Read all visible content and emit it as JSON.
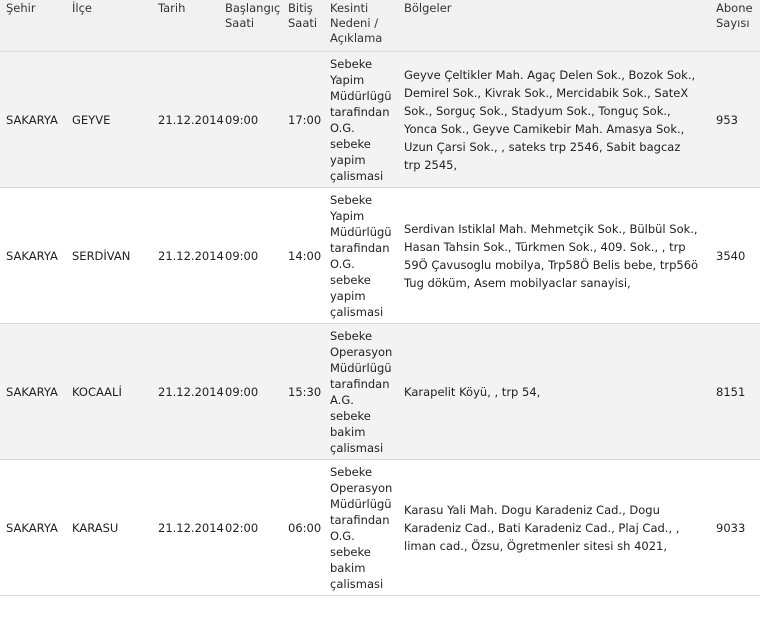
{
  "table": {
    "headers": {
      "city": "Şehir",
      "district": "İlçe",
      "date": "Tarih",
      "start_time": "Başlangıç\nSaati",
      "end_time": "Bitiş\nSaati",
      "reason": "Kesinti\nNedeni /\nAçıklama",
      "regions": "Bölgeler",
      "subscriber_count": "Abone\nSayısı"
    },
    "rows": [
      {
        "city": "SAKARYA",
        "district": "GEYVE",
        "date": "21.12.2014",
        "start_time": "09:00",
        "end_time": "17:00",
        "reason": "Sebeke\nYapim\nMüdürlügü\ntarafindan\nO.G.\nsebeke\nyapim\nçalismasi",
        "regions": "Geyve Çeltikler Mah. Agaç Delen Sok., Bozok Sok., Demirel Sok., Kivrak Sok., Mercidabik Sok., SateX Sok., Sorguç Sok., Stadyum Sok., Tonguç Sok., Yonca Sok., Geyve Camikebir Mah. Amasya Sok., Uzun Çarsi Sok., , sateks trp 2546, Sabit bagcaz trp 2545,",
        "subscriber_count": "953"
      },
      {
        "city": "SAKARYA",
        "district": "SERDİVAN",
        "date": "21.12.2014",
        "start_time": "09:00",
        "end_time": "14:00",
        "reason": "Sebeke\nYapim\nMüdürlügü\ntarafindan\nO.G.\nsebeke\nyapim\nçalismasi",
        "regions": "Serdivan Istiklal Mah. Mehmetçik Sok., Bülbül Sok., Hasan Tahsin Sok., Türkmen Sok., 409. Sok., , trp 59Ö Çavusoglu mobilya, Trp58Ö Belis bebe, trp56ö Tug döküm, Asem mobilyaclar sanayisi,",
        "subscriber_count": "3540"
      },
      {
        "city": "SAKARYA",
        "district": "KOCAALİ",
        "date": "21.12.2014",
        "start_time": "09:00",
        "end_time": "15:30",
        "reason": "Sebeke\nOperasyon\nMüdürlügü\ntarafindan\nA.G.\nsebeke\nbakim\nçalismasi",
        "regions": "Karapelit Köyü, , trp 54,",
        "subscriber_count": "8151"
      },
      {
        "city": "SAKARYA",
        "district": "KARASU",
        "date": "21.12.2014",
        "start_time": "02:00",
        "end_time": "06:00",
        "reason": "Sebeke\nOperasyon\nMüdürlügü\ntarafindan\nO.G.\nsebeke\nbakim\nçalismasi",
        "regions": "Karasu Yali Mah. Dogu Karadeniz Cad., Dogu Karadeniz Cad., Bati Karadeniz Cad., Plaj Cad., , liman cad., Özsu, Ögretmenler sitesi sh 4021,",
        "subscriber_count": "9033"
      }
    ]
  }
}
